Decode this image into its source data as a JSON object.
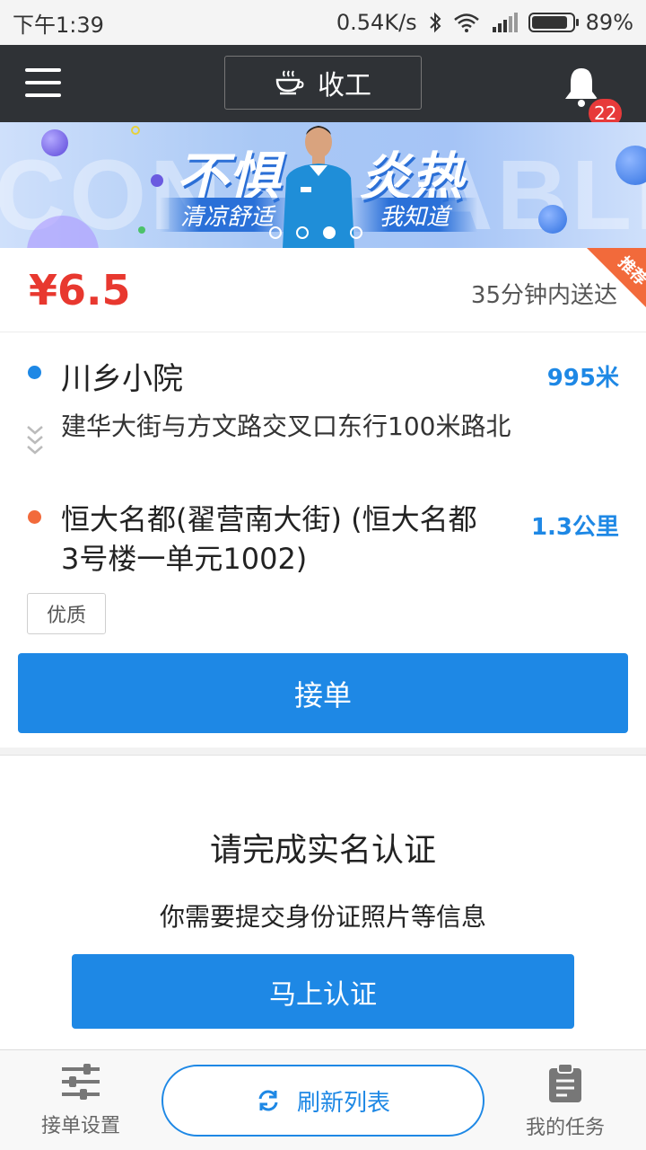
{
  "status_bar": {
    "time": "下午1:39",
    "network_speed": "0.54K/s",
    "battery": "89%",
    "battery_level": 0.89
  },
  "header": {
    "offwork_label": "收工",
    "notification_count": "22"
  },
  "banner": {
    "headline_left": "不惧",
    "headline_right": "炎热",
    "sub_left": "清凉舒适",
    "sub_right": "我知道",
    "bg_word_left": "CON",
    "bg_word_right": "ABLE",
    "slide_count": 4,
    "active_slide": 2
  },
  "order": {
    "price": "¥6.5",
    "delivery_time": "35分钟内送达",
    "corner_tag": "推荐",
    "shop_name": "川乡小院",
    "shop_distance": "995米",
    "shop_address": "建华大街与方文路交叉口东行100米路北",
    "dest_address": "恒大名都(翟营南大街) (恒大名都3号楼一单元1002)",
    "dest_distance": "1.3公里",
    "tag": "优质",
    "accept_label": "接单"
  },
  "verification": {
    "title": "请完成实名认证",
    "subtitle": "你需要提交身份证照片等信息",
    "button_label": "马上认证"
  },
  "bottom_bar": {
    "settings_label": "接单设置",
    "refresh_label": "刷新列表",
    "tasks_label": "我的任务"
  },
  "colors": {
    "header_bg": "#2f3236",
    "accent_blue": "#1e88e5",
    "price_red": "#e8382f",
    "dest_orange": "#f26a3b",
    "badge_red": "#e73a3a"
  },
  "icons": {
    "menu": "menu-icon",
    "offwork": "coffee-cup-icon",
    "notification": "bell-icon",
    "settings": "sliders-icon",
    "refresh": "refresh-icon",
    "tasks": "clipboard-icon"
  }
}
